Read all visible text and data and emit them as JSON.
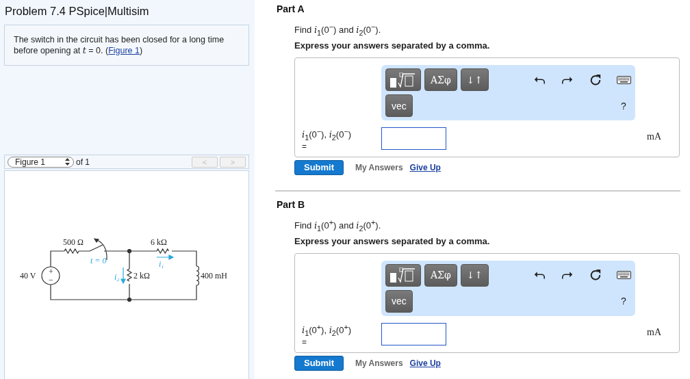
{
  "problem": {
    "title": "Problem 7.4 PSpice|Multisim",
    "description_before": "The switch in the circuit has been closed for a long time before opening at *t* = 0. (",
    "figure_link": "Figure 1",
    "description_after": ")"
  },
  "figure_viewer": {
    "select": "Figure 1",
    "of_text": "of 1",
    "prev": {
      "label": "<",
      "disabled": true
    },
    "next": {
      "label": ">",
      "disabled": true
    }
  },
  "circuit": {
    "labels": [
      {
        "kind": "value",
        "text": "500 Ω"
      },
      {
        "kind": "value",
        "text": "6 kΩ"
      },
      {
        "kind": "annotation",
        "text": "t = 0"
      },
      {
        "kind": "annotation",
        "text": "i₁"
      },
      {
        "kind": "value",
        "text": "40 V"
      },
      {
        "kind": "value",
        "text": "+"
      },
      {
        "kind": "value",
        "text": "−"
      },
      {
        "kind": "annotation",
        "text": "i₂"
      },
      {
        "kind": "value",
        "text": "2 kΩ"
      },
      {
        "kind": "value",
        "text": "400 mH"
      }
    ]
  },
  "parts": [
    {
      "title": "Part A",
      "prompt": "Find *i*$_{1}$(0$^{−}$) and *i*$_{2}$(0$^{−}$).",
      "instruction": "Express your answers separated by a comma.",
      "toolbar": {
        "buttons": [
          {
            "kind": "template"
          },
          {
            "kind": "text",
            "label": "ΑΣφ"
          },
          {
            "kind": "text",
            "label": "↓↑"
          }
        ],
        "second_row": [
          {
            "kind": "text",
            "label": "vec"
          }
        ],
        "help": "?"
      },
      "answer_label": "*i*$_{1}$(0$^{−}$), *i*$_{2}$(0$^{−}$)",
      "equals": "=",
      "unit": "mA",
      "submit": "Submit",
      "my_answers": "My Answers",
      "give_up": "Give Up"
    },
    {
      "title": "Part B",
      "prompt": "Find *i*$_{1}$(0$^{+}$) and *i*$_{2}$(0$^{+}$).",
      "instruction": "Express your answers separated by a comma.",
      "toolbar": {
        "buttons": [
          {
            "kind": "template"
          },
          {
            "kind": "text",
            "label": "ΑΣφ"
          },
          {
            "kind": "text",
            "label": "↓↑"
          }
        ],
        "second_row": [
          {
            "kind": "text",
            "label": "vec"
          }
        ],
        "help": "?"
      },
      "answer_label": "*i*$_{1}$(0$^{+}$), *i*$_{2}$(0$^{+}$)",
      "equals": "=",
      "unit": "mA",
      "submit": "Submit",
      "my_answers": "My Answers",
      "give_up": "Give Up"
    }
  ]
}
